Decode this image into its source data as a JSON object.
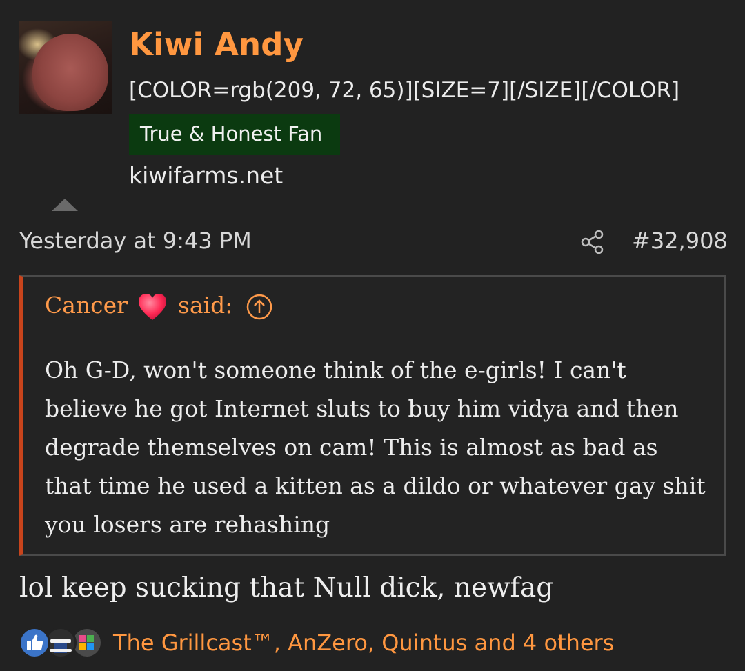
{
  "user": {
    "name": "Kiwi Andy",
    "custom_title": "[COLOR=rgb(209, 72, 65)][SIZE=7][/SIZE][/COLOR]",
    "banner": "True & Honest Fan",
    "website": "kiwifarms.net"
  },
  "post": {
    "timestamp": "Yesterday at 9:43 PM",
    "number": "#32,908"
  },
  "quote": {
    "author": "Cancer",
    "said": "said:",
    "body": "Oh G-D, won't someone think of the e-girls! I can't believe he got Internet sluts to buy him vidya and then degrade themselves on cam! This is almost as bad as that time he used a kitten as a dildo or whatever gay shit you losers are rehashing"
  },
  "reply": "lol keep sucking that Null dick, newfag",
  "reactions": {
    "icons": [
      "like-icon",
      "top-hat-icon",
      "autism-puzzle-icon"
    ],
    "users": "The Grillcast™, AnZero, Quintus and 4 others"
  },
  "colors": {
    "background": "#222222",
    "username": "#ff9740",
    "banner_bg": "#0b3a10",
    "quote_accent": "#c8441c",
    "quote_author": "#ff9a4a"
  }
}
